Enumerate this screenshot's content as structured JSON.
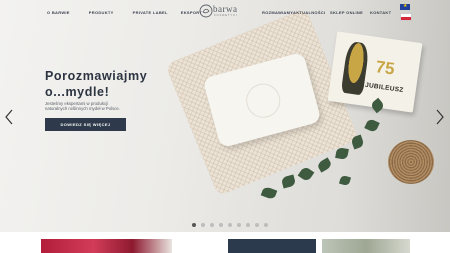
{
  "nav": {
    "left_items": [
      "O BARWIE",
      "PRODUKTY",
      "PRIVATE LABEL",
      "EKSPORT"
    ],
    "right_items": [
      "ROZMAWIAMY",
      "AKTUALNOŚCI",
      "SKLEP ONLINE",
      "KONTAKT"
    ],
    "languages": [
      "EN",
      "PL"
    ]
  },
  "logo": {
    "text": "barwa",
    "sub": "KOSMETYKI"
  },
  "hero": {
    "headline_line1": "Porozmawiajmy",
    "headline_line2": "o...mydle!",
    "subtext_line1": "Jesteśmy ekspertami w produkcji",
    "subtext_line2": "naturalnych roślinnych mydeł w Polsce.",
    "cta_label": "DOWIEDZ SIĘ WIĘCEJ",
    "box_number": "75",
    "box_label": "JUBILEUSZ"
  },
  "slider": {
    "total": 9,
    "active": 1
  },
  "colors": {
    "cta_bg": "#2e3a4b",
    "text_dark": "#2d3441",
    "accent_gold": "#c8a545"
  }
}
